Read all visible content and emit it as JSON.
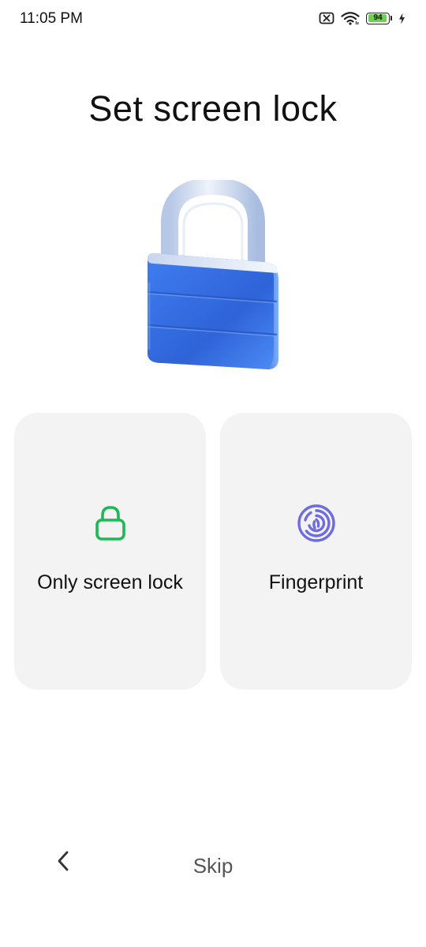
{
  "status_bar": {
    "time": "11:05 PM",
    "icons": [
      "sim-off-icon",
      "wifi-icon",
      "battery-icon",
      "charging-icon"
    ],
    "battery_level": "94",
    "battery_color": "#6ad24c"
  },
  "page": {
    "title": "Set screen lock",
    "hero_icon": "padlock-illustration"
  },
  "options": [
    {
      "label": "Only screen lock",
      "icon": "lock-icon",
      "icon_color": "#1db954"
    },
    {
      "label": "Fingerprint",
      "icon": "fingerprint-icon",
      "icon_color": "#6f6ce0"
    }
  ],
  "footer": {
    "back_icon": "chevron-left-icon",
    "skip_label": "Skip"
  },
  "colors": {
    "card_background": "#f3f3f3",
    "lock_blue": "#3a78e8"
  }
}
